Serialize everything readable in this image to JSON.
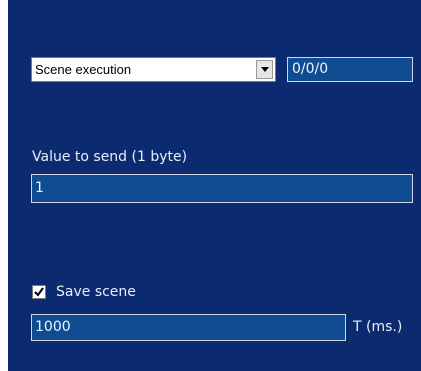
{
  "dropdown": {
    "selected": "Scene execution",
    "icon": "chevron-down-icon"
  },
  "address": {
    "value": "0/0/0"
  },
  "value_section": {
    "label": "Value to send (1 byte)",
    "value": "1"
  },
  "save_scene": {
    "label": "Save scene",
    "checked": true
  },
  "time": {
    "value": "1000",
    "unit_label": "T (ms.)"
  },
  "colors": {
    "panel_bg": "#0b2a6f",
    "field_bg": "#0f4c92",
    "field_border": "#cfd7e6",
    "text_light": "#e9eef8"
  }
}
